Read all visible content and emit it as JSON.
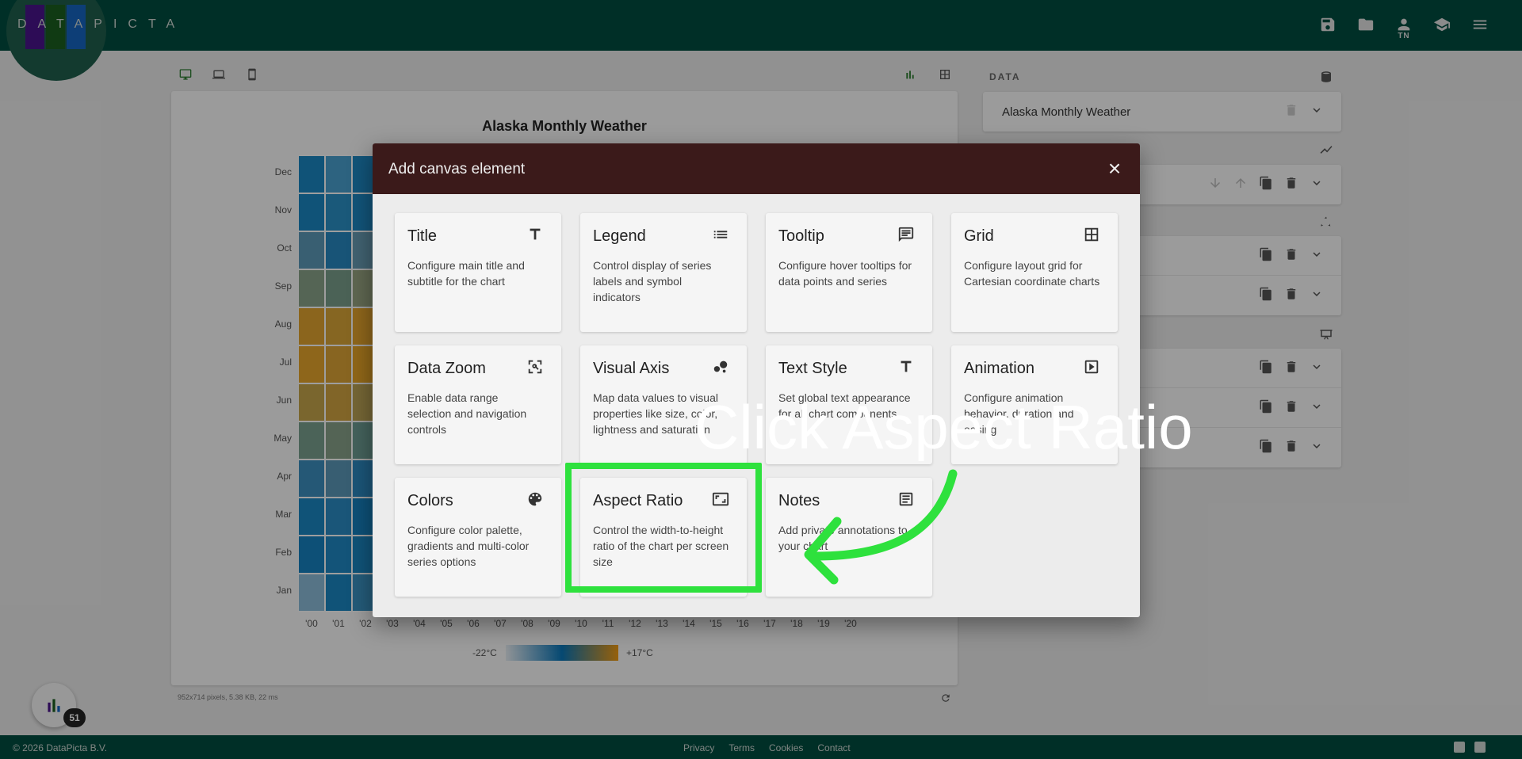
{
  "app": {
    "logo_text": "DATAPICTA",
    "user_initials": "TN"
  },
  "chart": {
    "title": "Alaska Monthly Weather",
    "legend_min": "-22°C",
    "legend_max": "+17°C",
    "footer_info": "952x714 pixels, 5.38 KB, 22 ms"
  },
  "chart_data": {
    "type": "heatmap",
    "title": "Alaska Monthly Weather",
    "y_categories": [
      "Dec",
      "Nov",
      "Oct",
      "Sep",
      "Aug",
      "Jul",
      "Jun",
      "May",
      "Apr",
      "Mar",
      "Feb",
      "Jan"
    ],
    "x_categories": [
      "'00",
      "'01",
      "'02",
      "'03",
      "'04",
      "'05",
      "'06",
      "'07",
      "'08",
      "'09",
      "'10",
      "'11",
      "'12",
      "'13",
      "'14",
      "'15",
      "'16",
      "'17",
      "'18",
      "'19",
      "'20"
    ],
    "color_range": [
      "-22°C",
      "+17°C"
    ],
    "colors": {
      "cold": "#e8eef3",
      "mid": "#0a76b8",
      "warm": "#f39c12"
    }
  },
  "right_panel": {
    "data_heading": "DATA",
    "dataset_name": "Alaska Monthly Weather"
  },
  "modal": {
    "title": "Add canvas element",
    "close": "×",
    "tiles": [
      {
        "name": "Title",
        "desc": "Configure main title and subtitle for the chart",
        "icon": "title-icon"
      },
      {
        "name": "Legend",
        "desc": "Control display of series labels and symbol indicators",
        "icon": "legend-list-icon"
      },
      {
        "name": "Tooltip",
        "desc": "Configure hover tooltips for data points and series",
        "icon": "tooltip-icon"
      },
      {
        "name": "Grid",
        "desc": "Configure layout grid for Cartesian coordinate charts",
        "icon": "grid-icon"
      },
      {
        "name": "Data Zoom",
        "desc": "Enable data range selection and navigation controls",
        "icon": "zoom-icon"
      },
      {
        "name": "Visual Axis",
        "desc": "Map data values to visual properties like size, color, lightness and saturation",
        "icon": "bubbles-icon"
      },
      {
        "name": "Text Style",
        "desc": "Set global text appearance for all chart components",
        "icon": "text-style-icon"
      },
      {
        "name": "Animation",
        "desc": "Configure animation behavior, duration and easing",
        "icon": "play-icon"
      },
      {
        "name": "Colors",
        "desc": "Configure color palette, gradients and multi-color series options",
        "icon": "palette-icon"
      },
      {
        "name": "Aspect Ratio",
        "desc": "Control the width-to-height ratio of the chart per screen size",
        "icon": "aspect-ratio-icon"
      },
      {
        "name": "Notes",
        "desc": "Add private annotations to your chart",
        "icon": "notes-icon"
      }
    ]
  },
  "annotation": {
    "text": "Click Aspect Ratio",
    "color": "#2ee13d"
  },
  "footer": {
    "copyright": "© 2026 DataPicta B.V.",
    "links": [
      "Privacy",
      "Terms",
      "Cookies",
      "Contact"
    ]
  },
  "fab": {
    "badge": "51"
  }
}
